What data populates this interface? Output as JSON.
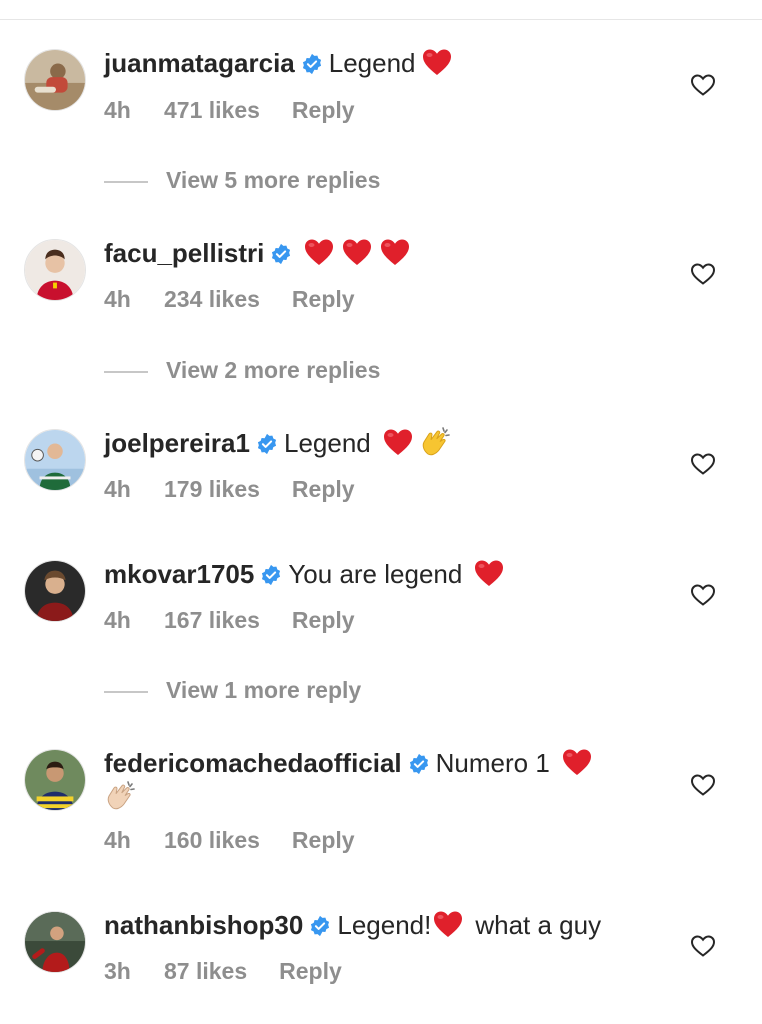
{
  "comments": [
    {
      "username": "juanmatagarcia",
      "text": "Legend",
      "emojis": [
        "red-heart"
      ],
      "time": "4h",
      "likes": "471 likes",
      "reply": "Reply",
      "avatar_colors": [
        "#c9b9a0",
        "#8a6a4a"
      ]
    },
    {
      "username": "facu_pellistri",
      "text": "",
      "emojis": [
        "red-heart",
        "red-heart",
        "red-heart"
      ],
      "time": "4h",
      "likes": "234 likes",
      "reply": "Reply",
      "avatar_colors": [
        "#efe9e4",
        "#c8102e"
      ]
    },
    {
      "username": "joelpereira1",
      "text": "Legend",
      "emojis": [
        "red-heart",
        "clapping-hands"
      ],
      "time": "4h",
      "likes": "179 likes",
      "reply": "Reply",
      "avatar_colors": [
        "#bcd6ee",
        "#1f6b3a"
      ]
    },
    {
      "username": "mkovar1705",
      "text": "You are legend",
      "emojis": [
        "red-heart"
      ],
      "time": "4h",
      "likes": "167 likes",
      "reply": "Reply",
      "avatar_colors": [
        "#2a2a2a",
        "#8b1a1a"
      ]
    },
    {
      "username": "federicomachedaofficial",
      "text": "Numero 1",
      "emojis": [
        "red-heart"
      ],
      "line2_emojis": [
        "clapping-hands-light"
      ],
      "time": "4h",
      "likes": "160 likes",
      "reply": "Reply",
      "avatar_colors": [
        "#6f8a5e",
        "#1f2d6b"
      ]
    },
    {
      "username": "nathanbishop30",
      "text": "Legend!",
      "emojis": [
        "red-heart"
      ],
      "text_after": "what a guy",
      "time": "3h",
      "likes": "87 likes",
      "reply": "Reply",
      "avatar_colors": [
        "#3b4a3a",
        "#b31b1b"
      ]
    }
  ],
  "view_more": [
    {
      "label": "View 5 more replies"
    },
    {
      "label": "View 2 more replies"
    },
    {
      "label": "View 1 more reply"
    }
  ],
  "colors": {
    "primary_text": "#262626",
    "secondary_text": "#8e8e8e",
    "verified_blue": "#3897f0",
    "heart_red": "#e0202b"
  },
  "icons": {
    "verified": "verified-badge-icon",
    "like": "heart-outline-icon"
  }
}
